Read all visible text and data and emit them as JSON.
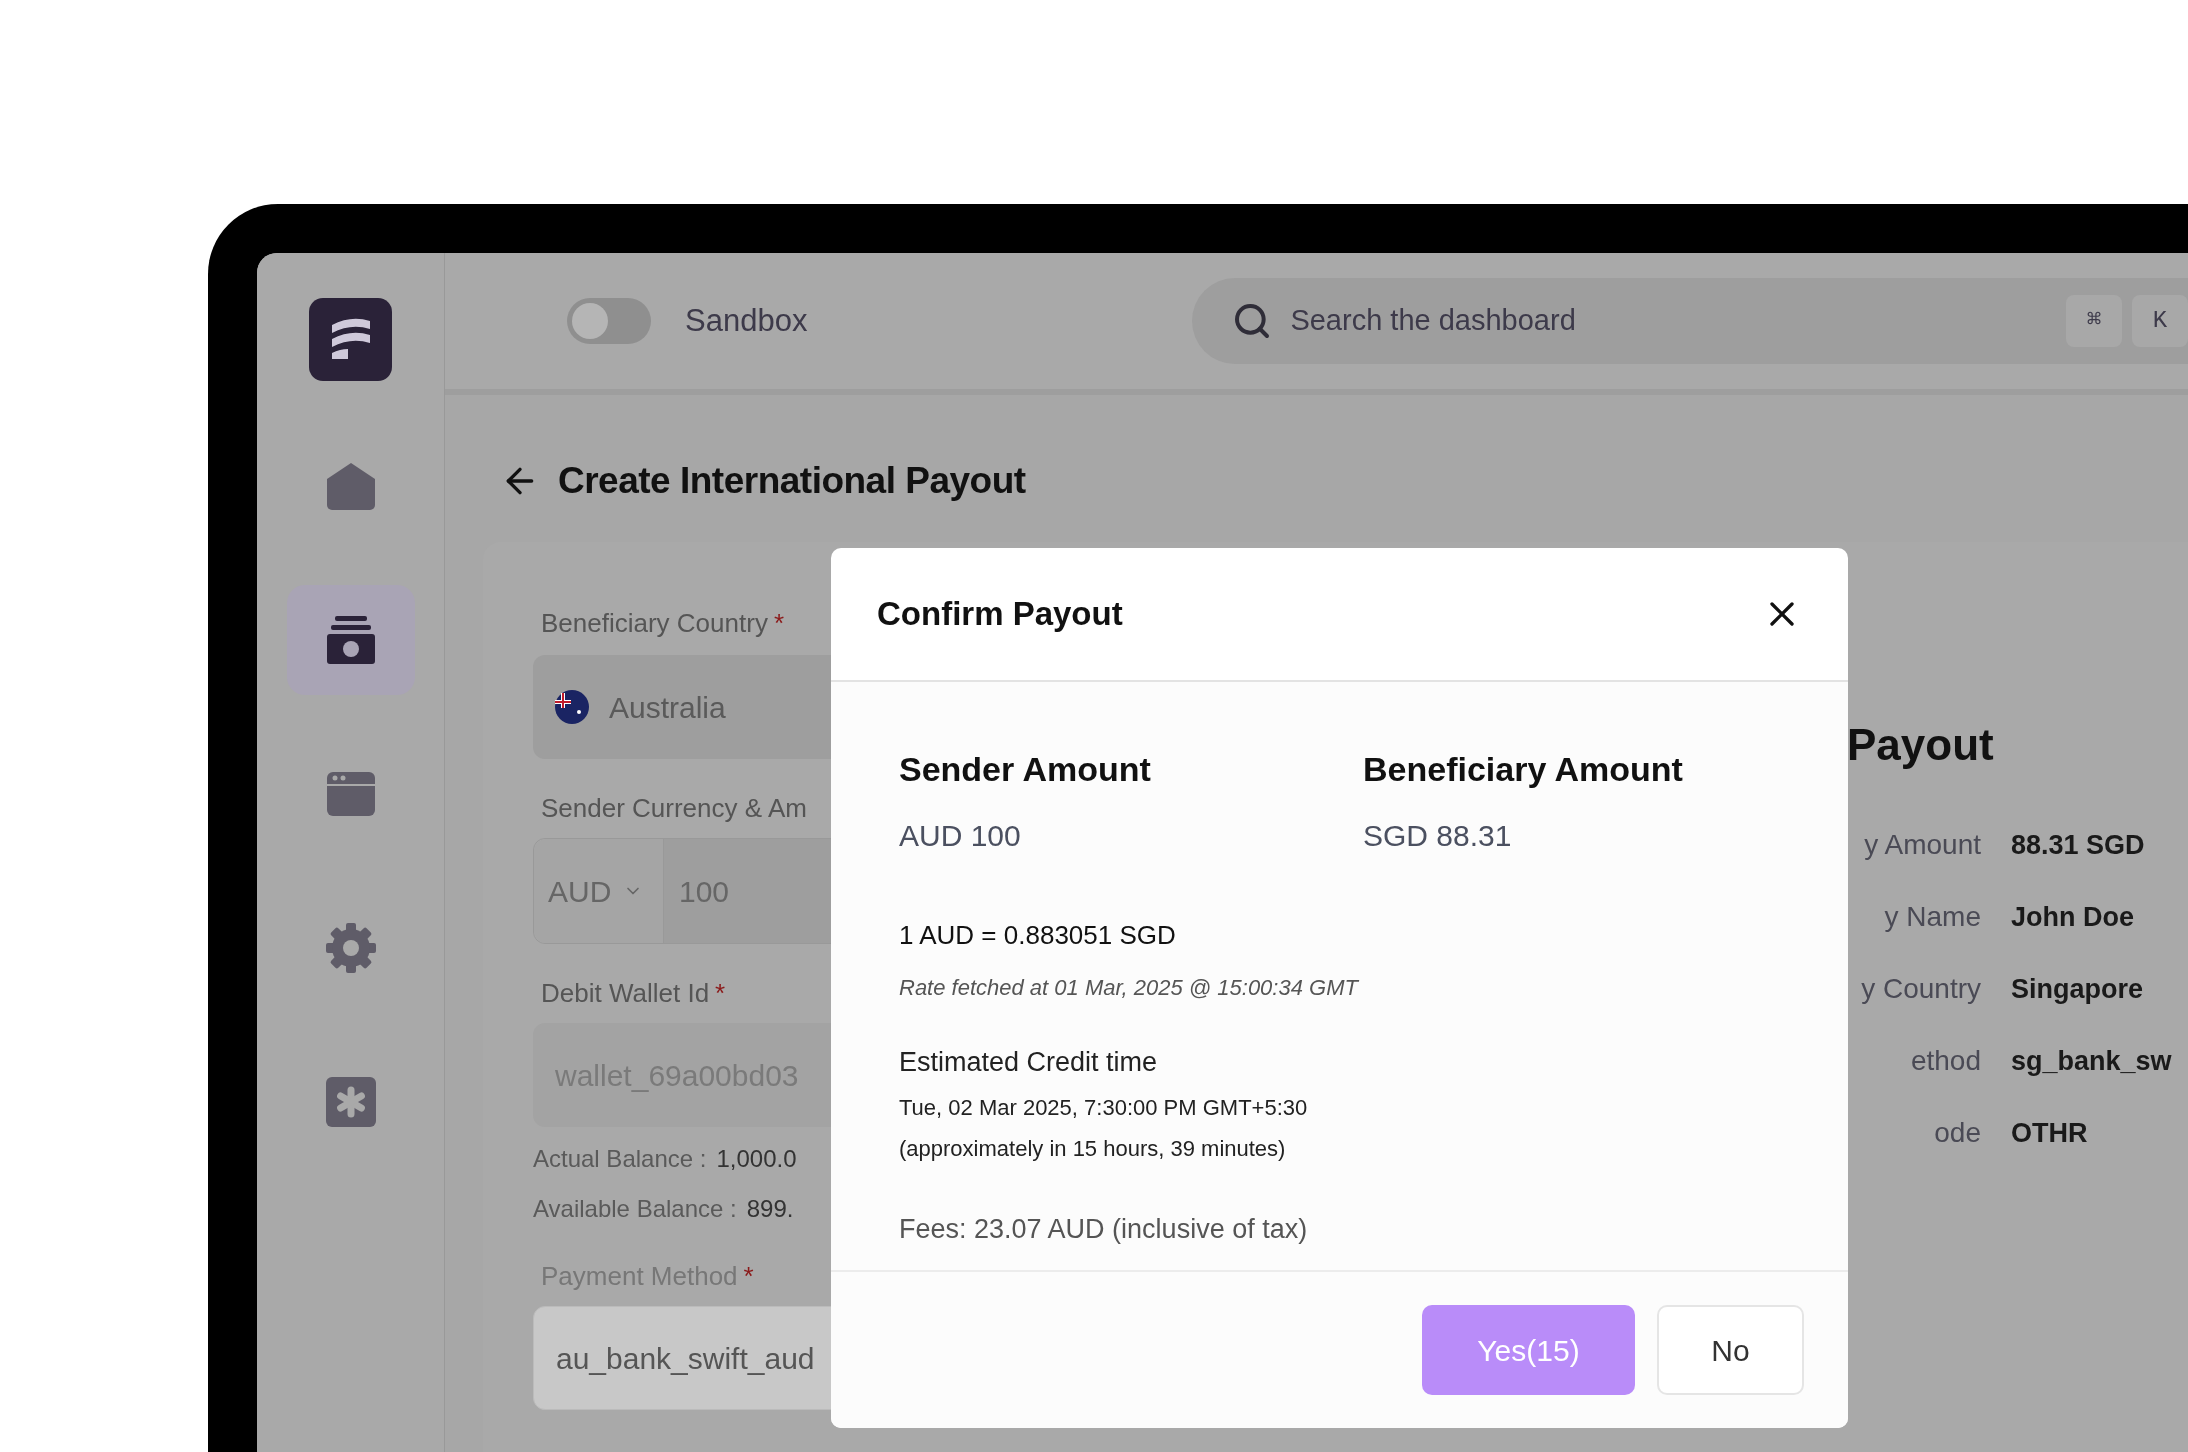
{
  "sandbox_toggle": {
    "label": "Sandbox",
    "on": false
  },
  "search": {
    "placeholder": "Search the dashboard",
    "shortcut": [
      "⌘",
      "K"
    ]
  },
  "sidebar": {
    "items": [
      {
        "kind": "home",
        "selected": false
      },
      {
        "kind": "wallet",
        "selected": true
      },
      {
        "kind": "card",
        "selected": false
      },
      {
        "kind": "settings",
        "selected": false
      },
      {
        "kind": "integrations",
        "selected": false
      }
    ]
  },
  "page": {
    "title": "Create International Payout"
  },
  "form": {
    "beneficiary_country": {
      "label": "Beneficiary Country",
      "required_mark": "*",
      "value": "Australia"
    },
    "sender_currency": {
      "label": "Sender Currency & Am",
      "currency": "AUD",
      "amount": "100"
    },
    "debit_wallet": {
      "label": "Debit Wallet Id",
      "required_mark": "*",
      "value": "wallet_69a00bd03"
    },
    "balances": [
      {
        "label": "Actual Balance :",
        "value": "1,000.0"
      },
      {
        "label": "Available Balance :",
        "value": "899."
      }
    ],
    "payment_method": {
      "label": "Payment Method",
      "required_mark": "*",
      "value": "au_bank_swift_aud"
    }
  },
  "summary": {
    "title": "Payout",
    "rows": [
      {
        "label": "y Amount",
        "value": "88.31 SGD"
      },
      {
        "label": "y Name",
        "value": "John Doe"
      },
      {
        "label": "y Country",
        "value": "Singapore"
      },
      {
        "label": "ethod",
        "value": "sg_bank_sw"
      },
      {
        "label": "ode",
        "value": "OTHR"
      }
    ]
  },
  "dialog": {
    "title": "Confirm Payout",
    "amounts": [
      {
        "label": "Sender Amount",
        "value": "AUD 100"
      },
      {
        "label": "Beneficiary Amount",
        "value": "SGD 88.31"
      }
    ],
    "rate": "1 AUD = 0.883051 SGD",
    "rate_note": "Rate fetched at 01 Mar, 2025 @ 15:00:34 GMT",
    "credit_label": "Estimated Credit time",
    "credit_time": "Tue, 02 Mar 2025, 7:30:00 PM GMT+5:30",
    "credit_eta": "(approximately in 15 hours, 39 minutes)",
    "fees": "Fees: 23.07 AUD (inclusive of tax)",
    "buttons": [
      {
        "label": "Yes(15)",
        "kind": "primary"
      },
      {
        "label": "No",
        "kind": "secondary"
      }
    ]
  }
}
